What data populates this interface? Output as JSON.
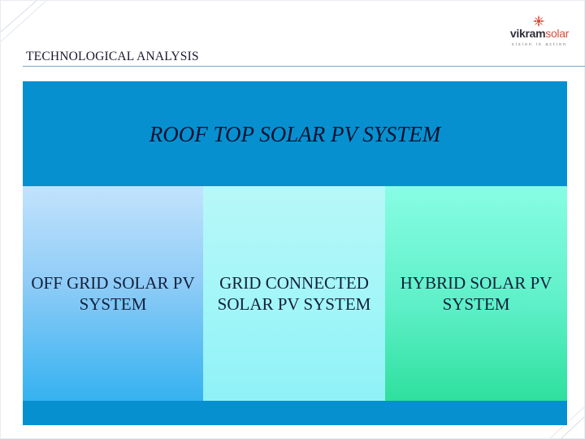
{
  "slide": {
    "title": "TECHNOLOGICAL ANALYSIS"
  },
  "logo": {
    "brand_part1": "vikram",
    "brand_part2": "solar",
    "tagline": "vision in action",
    "icon": "sun-flower-icon",
    "color_primary": "#2f2f3a",
    "color_accent": "#d64f3c"
  },
  "diagram": {
    "header": "ROOF TOP SOLAR PV SYSTEM",
    "columns": [
      {
        "label": "OFF GRID SOLAR PV SYSTEM"
      },
      {
        "label": "GRID CONNECTED SOLAR PV SYSTEM"
      },
      {
        "label": "HYBRID SOLAR PV SYSTEM"
      }
    ],
    "colors": {
      "frame": "#0790d0",
      "col1": "#8fccf7",
      "col2": "#a4f6f8",
      "col3": "#5ef0c8"
    }
  }
}
